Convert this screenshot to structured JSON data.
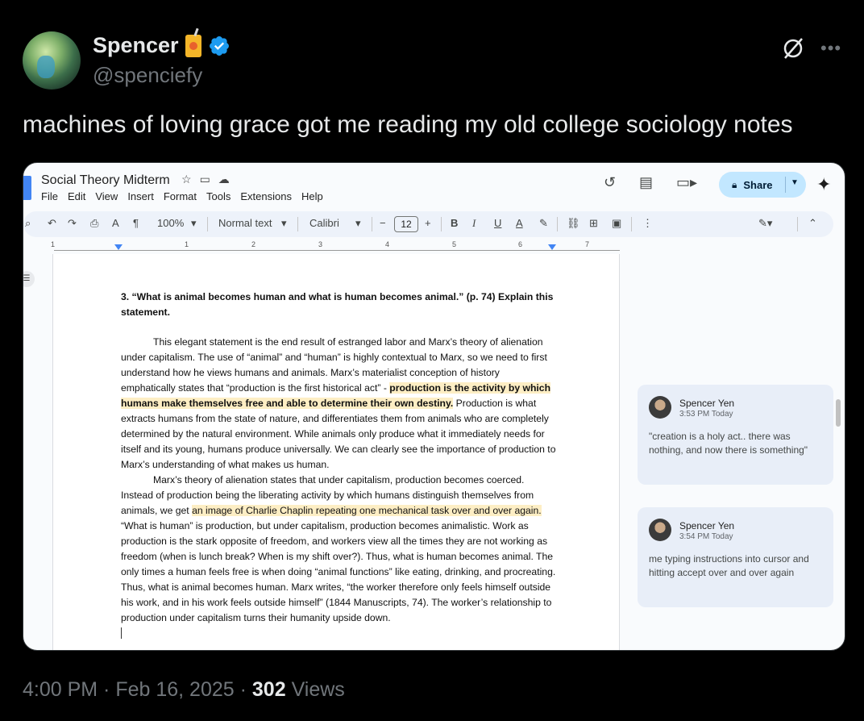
{
  "tweet": {
    "author_name": "Spencer",
    "handle": "@spenciefy",
    "text": "machines of loving grace got me reading my old college sociology notes",
    "time": "4:00 PM",
    "date": "Feb 16, 2025",
    "views_count": "302",
    "views_label": "Views",
    "icons": [
      "juice-box-emoji-icon",
      "verified-badge-icon",
      "grok-icon",
      "more-icon"
    ]
  },
  "docs": {
    "title": "Social Theory Midterm",
    "menu": [
      "File",
      "Edit",
      "View",
      "Insert",
      "Format",
      "Tools",
      "Extensions",
      "Help"
    ],
    "share_label": "Share",
    "toolbar": {
      "zoom": "100%",
      "style": "Normal text",
      "font": "Calibri",
      "font_size": "12",
      "minus": "−",
      "plus": "+"
    },
    "ruler_numbers": [
      "1",
      "1",
      "2",
      "3",
      "4",
      "5",
      "6",
      "7"
    ],
    "question": "3. “What is animal becomes human and what is human becomes animal.” (p. 74) Explain this statement.",
    "p1_a": "This elegant statement is the end result of estranged labor and Marx’s theory of alienation under capitalism. The use of “animal” and “human” is highly contextual to Marx, so we need to first understand how he views humans and animals. Marx’s materialist conception of history emphatically states that “production is the first historical act” - ",
    "p1_hl": "production is the activity by which humans make themselves free and able to determine their own destiny.",
    "p1_b": " Production is what extracts humans from the state of nature, and differentiates them from animals who are completely determined by the natural environment. While animals only produce what it immediately needs for itself and its young, humans produce universally. We can clearly see the importance of production to Marx’s understanding of what makes us human.",
    "p2_a": "Marx’s theory of alienation states that under capitalism, production becomes coerced. Instead of production being the liberating activity by which humans distinguish themselves from animals, we get ",
    "p2_hl": "an image of Charlie Chaplin repeating one mechanical task over and over again.",
    "p2_b": " “What is human” is production, but under capitalism, production becomes animalistic. Work as production is the stark opposite of freedom, and workers view all the times they are not working as freedom (when is lunch break? When is my shift over?). Thus, what is human becomes animal. The only times a human feels free is when doing “animal functions” like eating, drinking, and procreating. Thus, what is animal becomes human. Marx writes, “the worker therefore only feels himself outside his work, and in his work feels outside himself” (1844 Manuscripts, 74). The worker’s relationship to production under capitalism turns their humanity upside down.",
    "comments": [
      {
        "author": "Spencer Yen",
        "time": "3:53 PM Today",
        "text": "\"creation is a holy act.. there was nothing, and now there is something\""
      },
      {
        "author": "Spencer Yen",
        "time": "3:54 PM Today",
        "text": "me typing instructions into cursor and hitting accept over and over again"
      }
    ]
  }
}
